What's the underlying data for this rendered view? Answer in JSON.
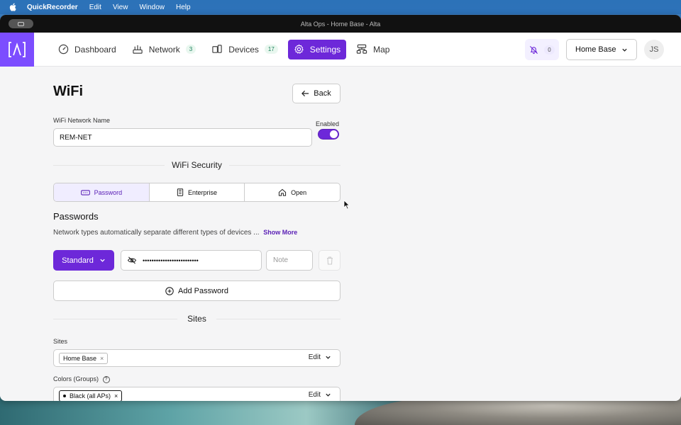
{
  "menubar": {
    "app_name": "QuickRecorder",
    "items": [
      "Edit",
      "View",
      "Window",
      "Help"
    ]
  },
  "window": {
    "title": "Alta Ops - Home Base - Alta"
  },
  "nav": {
    "items": [
      {
        "label": "Dashboard",
        "icon": "gauge-icon"
      },
      {
        "label": "Network",
        "icon": "router-icon",
        "count": "3"
      },
      {
        "label": "Devices",
        "icon": "devices-icon",
        "count": "17"
      },
      {
        "label": "Settings",
        "icon": "gear-icon",
        "active": true
      },
      {
        "label": "Map",
        "icon": "sitemap-icon"
      }
    ]
  },
  "header": {
    "notification_count": "0",
    "site_selector": "Home Base",
    "avatar_initials": "JS"
  },
  "page": {
    "title": "WiFi",
    "back_label": "Back"
  },
  "wifi": {
    "name_label": "WiFi Network Name",
    "name_value": "REM-NET",
    "enabled_label": "Enabled",
    "enabled": true
  },
  "security": {
    "title": "WiFi Security",
    "options": [
      {
        "label": "Password",
        "active": true
      },
      {
        "label": "Enterprise"
      },
      {
        "label": "Open"
      }
    ]
  },
  "passwords": {
    "heading": "Passwords",
    "description": "Network types automatically separate different types of devices ...",
    "show_more": "Show More",
    "type_button": "Standard",
    "password_masked": "•••••••••••••••••••••••••",
    "note_placeholder": "Note",
    "add_label": "Add Password"
  },
  "sites_section": {
    "title": "Sites",
    "sites_label": "Sites",
    "sites_chip": "Home Base",
    "edit_label": "Edit",
    "colors_label": "Colors (Groups)",
    "colors_chip": "Black (all APs)"
  },
  "colors": {
    "accent": "#6d28d9",
    "logo": "#7c4dff"
  }
}
